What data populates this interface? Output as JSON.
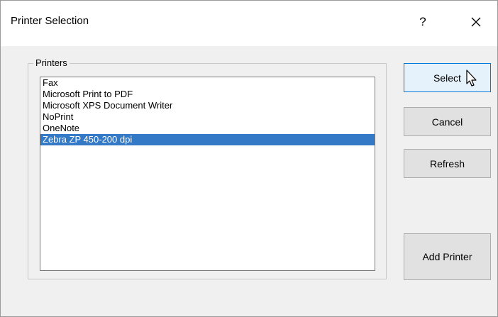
{
  "window": {
    "title": "Printer Selection",
    "help_glyph": "?",
    "close_icon": "close-icon"
  },
  "printers_group": {
    "label": "Printers",
    "items": [
      {
        "label": "Fax",
        "selected": false
      },
      {
        "label": "Microsoft Print to PDF",
        "selected": false
      },
      {
        "label": "Microsoft XPS Document Writer",
        "selected": false
      },
      {
        "label": "NoPrint",
        "selected": false
      },
      {
        "label": "OneNote",
        "selected": false
      },
      {
        "label": "Zebra  ZP 450-200 dpi",
        "selected": true
      }
    ]
  },
  "buttons": {
    "select": "Select",
    "cancel": "Cancel",
    "refresh": "Refresh",
    "add_printer": "Add Printer"
  },
  "colors": {
    "selection_bg": "#3379c5",
    "default_button_border": "#0078d7",
    "dialog_bg": "#f0f0f0"
  }
}
